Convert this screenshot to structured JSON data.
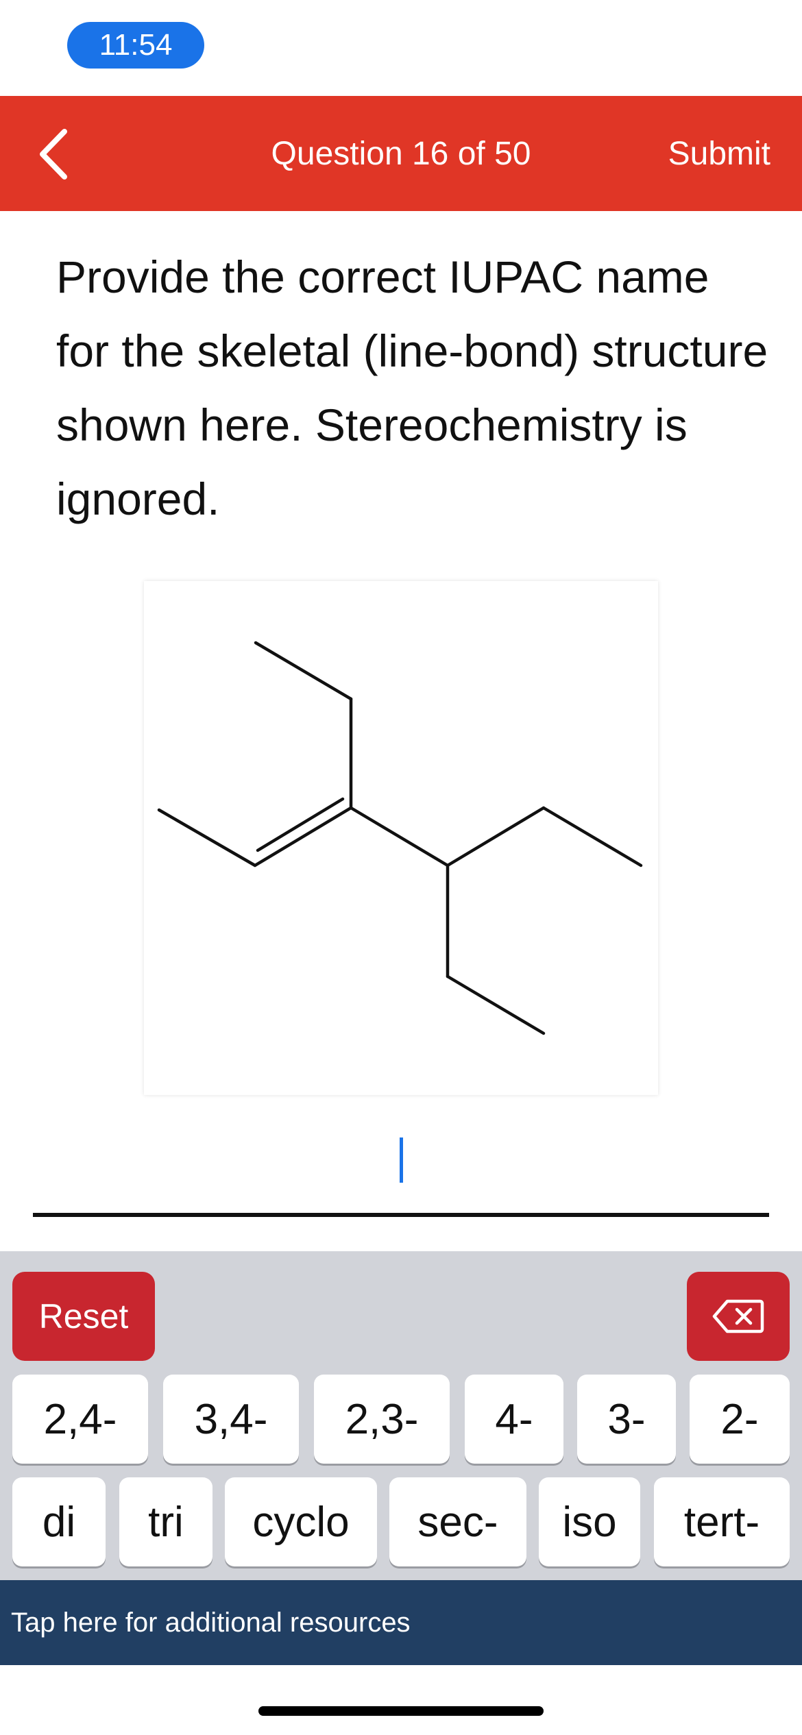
{
  "status_bar": {
    "time": "11:54"
  },
  "header": {
    "title": "Question 16 of 50",
    "submit_label": "Submit",
    "back_icon": "chevron-left-icon",
    "accent_color": "#e03626"
  },
  "question": {
    "text": "Provide the correct IUPAC name for the skeletal (line-bond) structure shown here. Stereochemistry is ignored."
  },
  "answer": {
    "value": ""
  },
  "keyboard": {
    "reset_label": "Reset",
    "delete_icon": "backspace-icon",
    "row1": [
      "2,4-",
      "3,4-",
      "2,3-",
      "4-",
      "3-",
      "2-"
    ],
    "row2": [
      "di",
      "tri",
      "cyclo",
      "sec-",
      "iso",
      "tert-"
    ],
    "button_color": "#c8262f"
  },
  "footer": {
    "resources_label": "Tap here for additional resources",
    "color": "#213f63"
  }
}
